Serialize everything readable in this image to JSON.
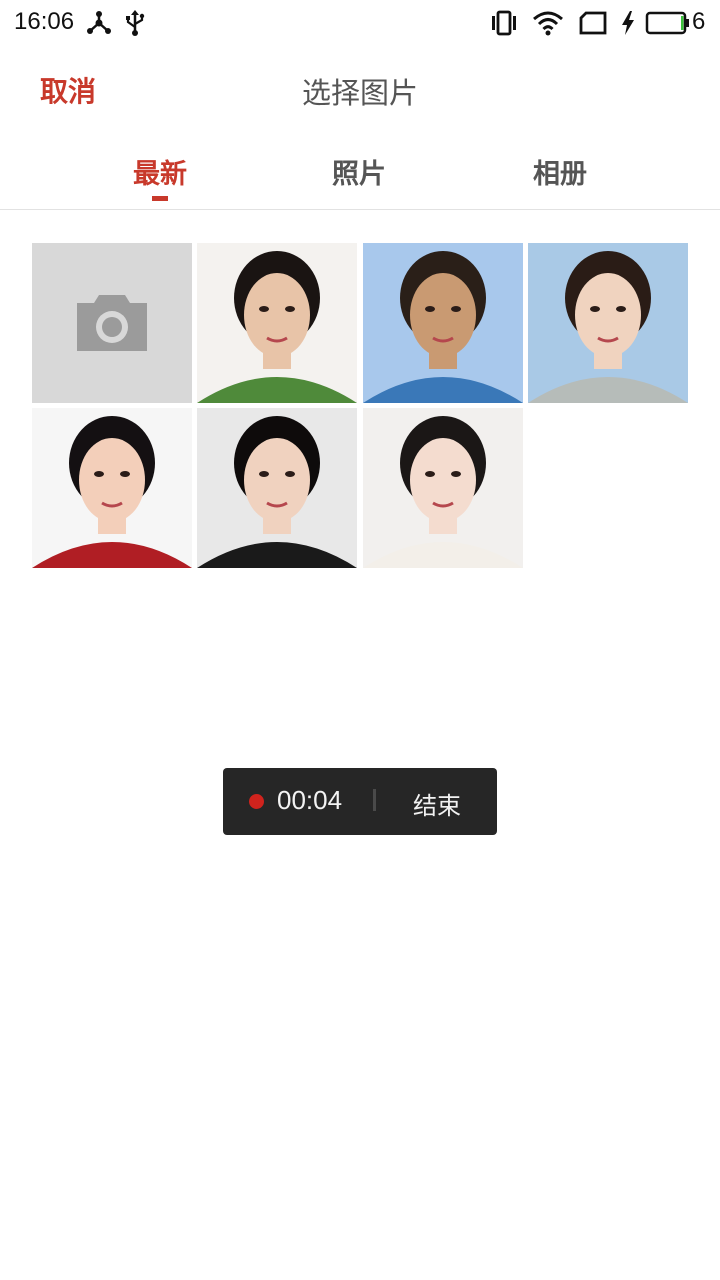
{
  "status_bar": {
    "time": "16:06",
    "battery_level": "6",
    "icons": [
      "network-icon",
      "usb-icon",
      "vibrate-icon",
      "wifi-icon",
      "sim-icon",
      "charging-icon",
      "battery-icon"
    ]
  },
  "header": {
    "cancel_label": "取消",
    "title": "选择图片"
  },
  "tabs": [
    {
      "label": "最新",
      "active": true
    },
    {
      "label": "照片",
      "active": false
    },
    {
      "label": "相册",
      "active": false
    }
  ],
  "grid": {
    "camera_tile_icon": "camera-icon",
    "photos": [
      {
        "name": "photo-1",
        "bg": "#f4f2ef",
        "skin": "#e8c4a8",
        "hair": "#1a1412",
        "shirt": "#4f8a3a"
      },
      {
        "name": "photo-2",
        "bg": "#a8c8ec",
        "skin": "#c99a72",
        "hair": "#2a1f18",
        "shirt": "#3a78b8"
      },
      {
        "name": "photo-3",
        "bg": "#a9c9e6",
        "skin": "#f0d3bf",
        "hair": "#2a1c16",
        "shirt": "#b6bcb9"
      },
      {
        "name": "photo-4",
        "bg": "#f6f6f6",
        "skin": "#f3cfba",
        "hair": "#141012",
        "shirt": "#b01e24"
      },
      {
        "name": "photo-5",
        "bg": "#e8e8e8",
        "skin": "#f0d2bf",
        "hair": "#0e0b0b",
        "shirt": "#1a1a1a"
      },
      {
        "name": "photo-6",
        "bg": "#f2f0ee",
        "skin": "#f4dccf",
        "hair": "#1b1716",
        "shirt": "#f3efe9"
      }
    ]
  },
  "recording": {
    "time": "00:04",
    "end_label": "结束"
  },
  "colors": {
    "accent": "#c8392b",
    "record_dot": "#d0231d"
  }
}
